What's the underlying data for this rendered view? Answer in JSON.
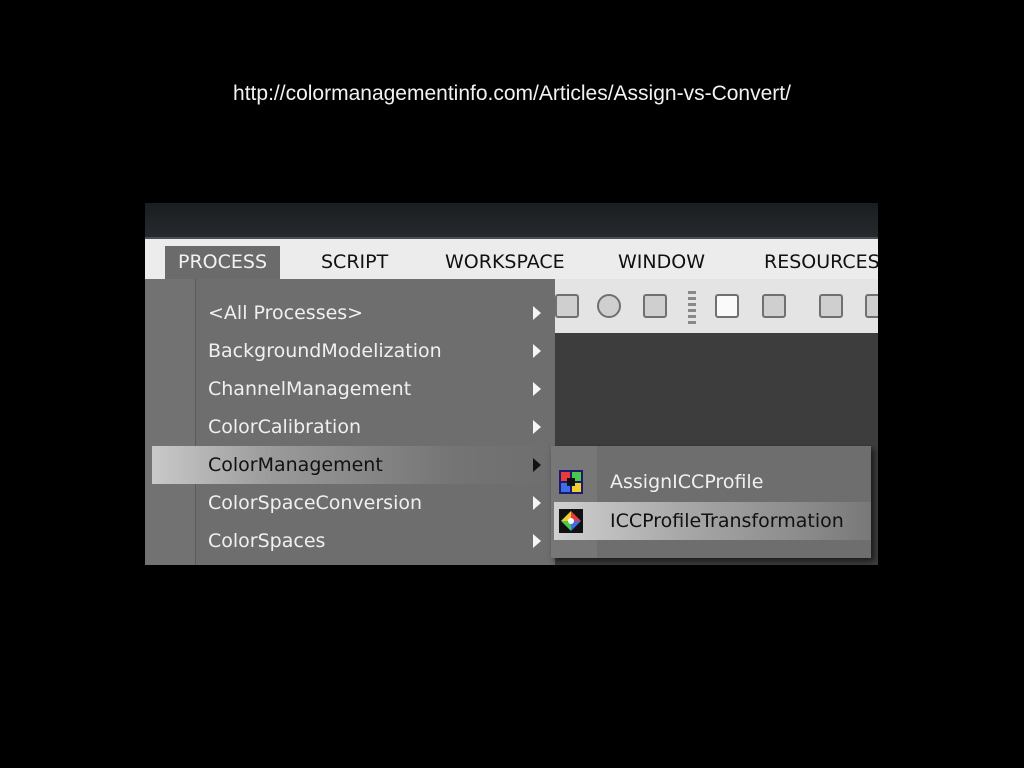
{
  "caption": {
    "url": "http://colormanagementinfo.com/Articles/Assign-vs-Convert/"
  },
  "menubar": {
    "items": [
      {
        "label": "PROCESS",
        "active": true
      },
      {
        "label": "SCRIPT"
      },
      {
        "label": "WORKSPACE"
      },
      {
        "label": "WINDOW"
      },
      {
        "label": "RESOURCES"
      }
    ]
  },
  "toolbar": {
    "icons": [
      "settings-icon",
      "refresh-icon",
      "cancel-icon",
      "separator-grip",
      "window-icon",
      "close-window-icon",
      "preview-icon",
      "window-partial-icon"
    ]
  },
  "process_menu": {
    "items": [
      {
        "label": "<All Processes>",
        "has_submenu": true
      },
      {
        "label": "BackgroundModelization",
        "has_submenu": true
      },
      {
        "label": "ChannelManagement",
        "has_submenu": true
      },
      {
        "label": "ColorCalibration",
        "has_submenu": true
      },
      {
        "label": "ColorManagement",
        "has_submenu": true,
        "highlighted": true
      },
      {
        "label": "ColorSpaceConversion",
        "has_submenu": true
      },
      {
        "label": "ColorSpaces",
        "has_submenu": true
      }
    ]
  },
  "submenu": {
    "items": [
      {
        "label": "AssignICCProfile",
        "icon": "assign-icc-profile-icon"
      },
      {
        "label": "ICCProfileTransformation",
        "icon": "icc-profile-transformation-icon",
        "highlighted": true
      }
    ]
  },
  "colors": {
    "background": "#000000",
    "menubar": "#ececec",
    "dropdown": "#6e6e6e",
    "highlight_start": "#c9c9c9"
  }
}
